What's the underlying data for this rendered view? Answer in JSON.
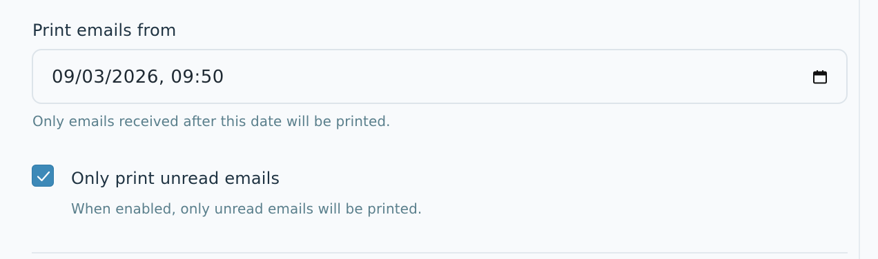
{
  "print_from": {
    "label": "Print emails from",
    "value": "09/03/2026, 09:50",
    "icon": "calendar-icon",
    "helper": "Only emails received after this date will be printed."
  },
  "unread_only": {
    "checked": true,
    "label": "Only print unread emails",
    "helper": "When enabled, only unread emails will be printed."
  },
  "colors": {
    "checkbox_accent": "#3d89b8",
    "label_text": "#1f3342",
    "helper_text": "#5a7f8c",
    "border": "#dde4ea",
    "background": "#f8fafc"
  }
}
